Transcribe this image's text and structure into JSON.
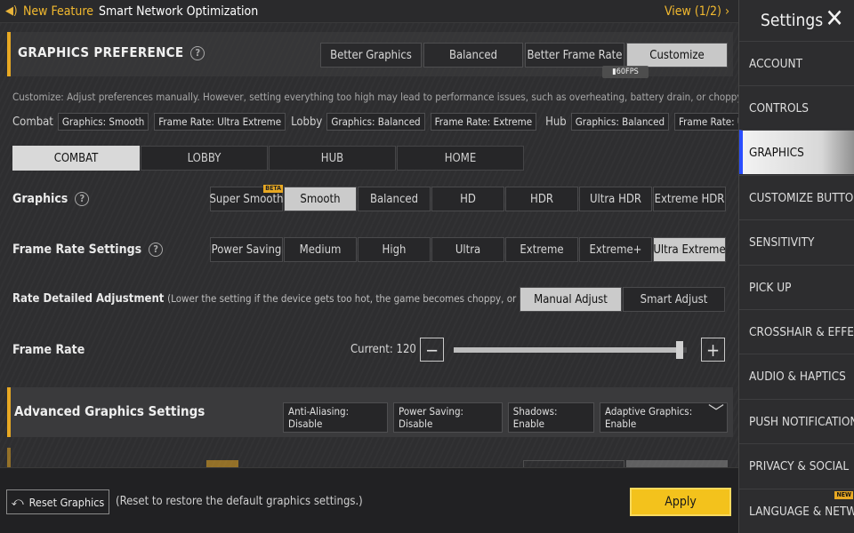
{
  "banner": {
    "icon": "speaker-icon",
    "new_label": "New Feature",
    "title": "Smart Network Optimization",
    "view": "View (1/2)"
  },
  "preference": {
    "title": "GRAPHICS PREFERENCE",
    "options": [
      "Better Graphics",
      "Balanced",
      "Better Frame Rate",
      "Customize"
    ],
    "selected": "Customize",
    "fps_tag": "60FPS"
  },
  "description": "Customize: Adjust preferences manually. However, setting everything too high may lead to performance issues, such as overheating, battery drain, or choppy gameplay.",
  "summary": {
    "combat_label": "Combat",
    "combat_graphics": "Graphics: Smooth",
    "combat_fps": "Frame Rate: Ultra Extreme",
    "lobby_label": "Lobby",
    "lobby_graphics": "Graphics: Balanced",
    "lobby_fps": "Frame Rate: Extreme",
    "hub_label": "Hub",
    "hub_graphics": "Graphics: Balanced",
    "hub_fps": "Frame Rate: Ultra"
  },
  "tabs": [
    "COMBAT",
    "LOBBY",
    "HUB",
    "HOME"
  ],
  "graphics": {
    "label": "Graphics",
    "options": [
      "Super Smooth",
      "Smooth",
      "Balanced",
      "HD",
      "HDR",
      "Ultra HDR",
      "Extreme HDR"
    ],
    "selected": "Smooth",
    "beta_badge": "BETA"
  },
  "frame_rate_settings": {
    "label": "Frame Rate Settings",
    "options": [
      "Power Saving",
      "Medium",
      "High",
      "Ultra",
      "Extreme",
      "Extreme+",
      "Ultra Extreme"
    ],
    "selected": "Ultra Extreme"
  },
  "adjustment": {
    "label": "Rate Detailed Adjustment",
    "note": "(Lower the setting if the device gets too hot, the game becomes choppy, or the battery",
    "manual": "Manual Adjust",
    "smart": "Smart Adjust",
    "selected": "Manual Adjust"
  },
  "frame_rate": {
    "label": "Frame Rate",
    "current": "Current: 120",
    "minus": "−",
    "plus": "+",
    "level": 0.97
  },
  "advanced": {
    "label": "Advanced Graphics Settings",
    "chips": [
      "Anti-Aliasing: Disable",
      "Power Saving: Disable",
      "Shadows: Enable",
      "Adaptive Graphics: Enable"
    ],
    "chevron_icon": "chevron-down-icon"
  },
  "bottom": {
    "reset_label": "Reset Graphics",
    "reset_note": "(Reset to restore the default graphics settings.)",
    "apply_label": "Apply"
  },
  "sidebar": {
    "title": "Settings",
    "items": [
      "ACCOUNT",
      "CONTROLS",
      "GRAPHICS",
      "CUSTOMIZE BUTTONS",
      "SENSITIVITY",
      "PICK UP",
      "CROSSHAIR & EFFECTS",
      "AUDIO & HAPTICS",
      "PUSH NOTIFICATIONS",
      "PRIVACY & SOCIAL",
      "LANGUAGE & NETWORK"
    ],
    "selected": "GRAPHICS",
    "new_badge": "NEW"
  },
  "colors": {
    "accent": "#e7a823",
    "apply": "#f3c21c",
    "selected": "#cbcbcb"
  }
}
